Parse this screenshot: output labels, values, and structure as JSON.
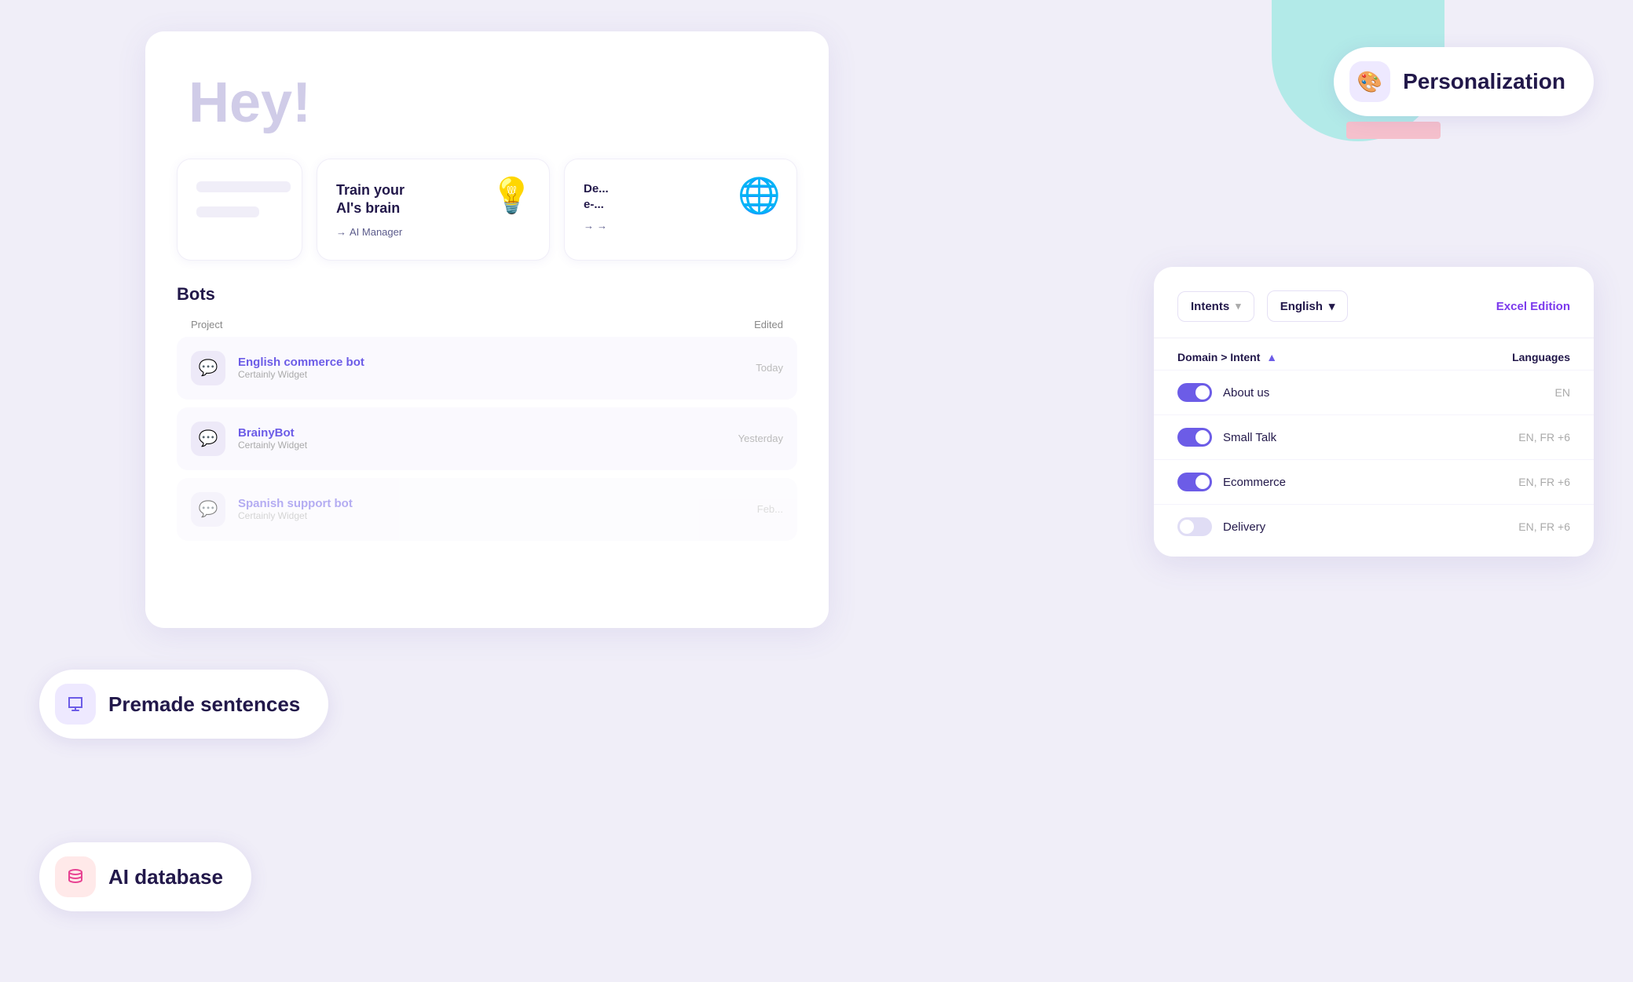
{
  "decorative": {
    "circle_teal_color": "#b2eae8",
    "circle_pink_color": "#f5b8c4"
  },
  "personalization": {
    "label": "Personalization",
    "icon": "🎨"
  },
  "premade": {
    "label": "Premade sentences",
    "icon": "💬"
  },
  "ai_database": {
    "label": "AI database",
    "icon": "🗄️"
  },
  "main_card": {
    "greeting": "Hey!",
    "feature_cards": [
      {
        "title": "Train your\nAl's brain",
        "link": "AI Manager",
        "icon": "💡",
        "icon_color": "#f5a623"
      },
      {
        "title": "De...\ne-...",
        "link": "",
        "icon": "🌐",
        "icon_color": "#e84393"
      }
    ],
    "bots": {
      "section_title": "Bots",
      "column_project": "Project",
      "column_edited": "Edited",
      "rows": [
        {
          "name": "English commerce bot",
          "subtitle": "Certainly Widget",
          "date": "Today",
          "faded": false
        },
        {
          "name": "BrainyBot",
          "subtitle": "Certainly Widget",
          "date": "Yesterday",
          "faded": false
        },
        {
          "name": "Spanish support bot",
          "subtitle": "Certainly Widget",
          "date": "Feb...",
          "faded": true
        }
      ]
    }
  },
  "intents_panel": {
    "dropdown_intents": "Intents",
    "dropdown_english": "English",
    "excel_button": "Excel Edition",
    "header_domain": "Domain > Intent",
    "header_languages": "Languages",
    "rows": [
      {
        "name": "About us",
        "languages": "EN",
        "enabled": true
      },
      {
        "name": "Small Talk",
        "languages": "EN, FR +6",
        "enabled": true
      },
      {
        "name": "Ecommerce",
        "languages": "EN, FR +6",
        "enabled": true
      },
      {
        "name": "Delivery",
        "languages": "EN, FR +6",
        "enabled": false
      }
    ]
  }
}
